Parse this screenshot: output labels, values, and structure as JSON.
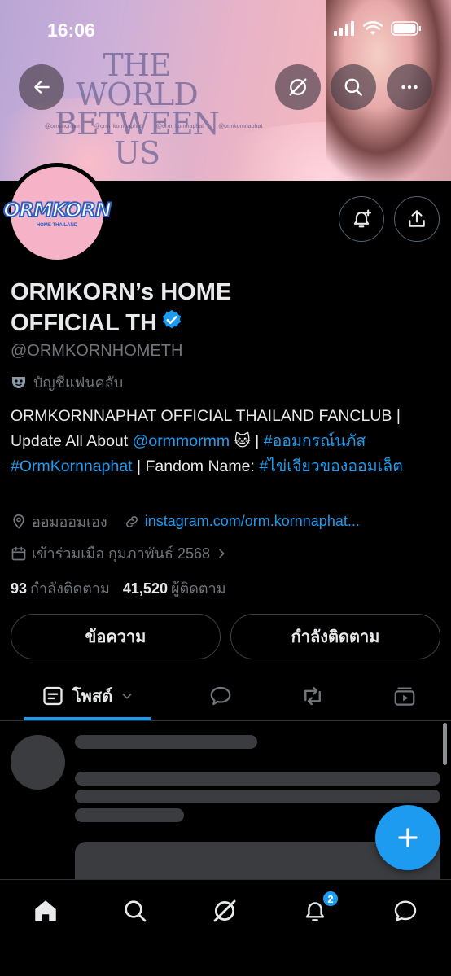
{
  "status_bar": {
    "time": "16:06"
  },
  "banner": {
    "title_line1": "THE WORLD",
    "title_line2": "BETWEEN US",
    "handles": [
      "@ormmormm",
      "@orm_kornnaphat",
      "@orm_kornnaphat",
      "@ormkornnaphat"
    ]
  },
  "avatar": {
    "logo_text": "ORMKORN",
    "sub_text": "HOME THAILAND"
  },
  "profile": {
    "name_line1": "ORMKORN’s HOME",
    "name_line2": "OFFICIAL TH",
    "handle": "@ORMKORNHOMETH",
    "category": "บัญชีแฟนคลับ",
    "bio": {
      "part1": "ORMKORNNAPHAT OFFICIAL THAILAND FANCLUB | Update All About ",
      "mention": "@ormmormm",
      "emoji": "🐱",
      "sep": " | ",
      "hashtag1": "#ออมกรณ์นภัส",
      "hashtag2": "#OrmKornnaphat",
      "part2": " | Fandom Name: ",
      "hashtag3": "#ไข่เจียวของออมเล็ต"
    },
    "location": "ออมออมเอง",
    "website": "instagram.com/orm.kornnaphat...",
    "joined": "เข้าร่วมเมือ กุมภาพันธ์ 2568",
    "following_count": "93",
    "following_label": "กำลังติดตาม",
    "followers_count": "41,520",
    "followers_label": "ผู้ติดตาม"
  },
  "actions": {
    "message_label": "ข้อความ",
    "following_label": "กำลังติดตาม"
  },
  "tabs": {
    "posts_label": "โพสต์"
  },
  "nav": {
    "notifications_badge": "2"
  },
  "colors": {
    "accent": "#1d9bf0",
    "background": "#000000",
    "secondary_text": "#71767b"
  }
}
